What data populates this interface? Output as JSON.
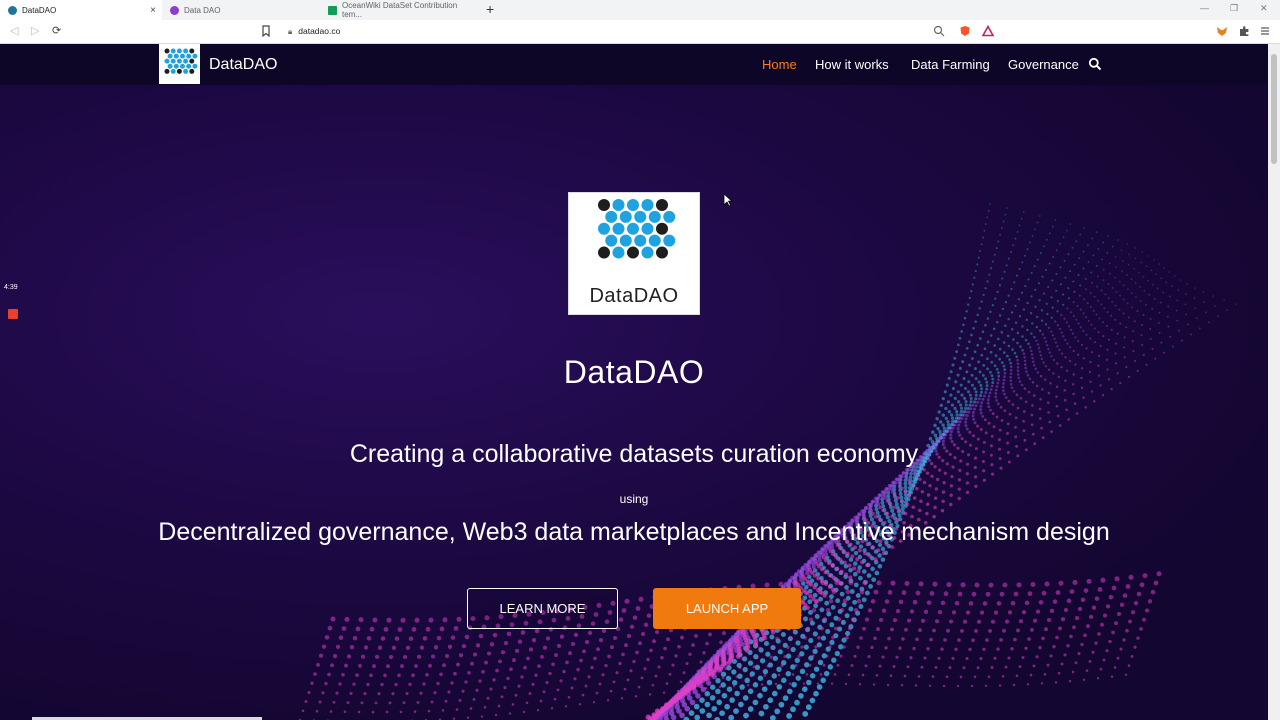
{
  "browser": {
    "tabs": [
      {
        "title": "DataDAO",
        "active": true,
        "favicon_color": "#21759b"
      },
      {
        "title": "Data DAO",
        "active": false,
        "favicon_color": "#8a3fd1"
      },
      {
        "title": "OceanWiki DataSet Contribution tem...",
        "active": false,
        "favicon_color": "#0f9d58"
      }
    ],
    "new_tab_label": "+",
    "url": "datadao.co"
  },
  "site": {
    "brand": "DataDAO",
    "nav": [
      {
        "label": "Home",
        "active": true
      },
      {
        "label": "How it works",
        "active": false
      },
      {
        "label": "Data Farming",
        "active": false
      },
      {
        "label": "Governance",
        "active": false
      }
    ],
    "hero": {
      "logo_text": "DataDAO",
      "title": "DataDAO",
      "tagline": "Creating a collaborative datasets curation economy",
      "using": "using",
      "subline": "Decentralized governance, Web3 data marketplaces and Incentive mechanism design",
      "learn_more": "LEARN MORE",
      "launch_app": "LAUNCH APP"
    },
    "colors": {
      "accent": "#f07a0e",
      "nav_bg": "#0e0626",
      "logo_dot_blue": "#1fa3e0",
      "logo_dot_dark": "#1e1e1e"
    }
  },
  "recorder": {
    "time": "4:39"
  }
}
